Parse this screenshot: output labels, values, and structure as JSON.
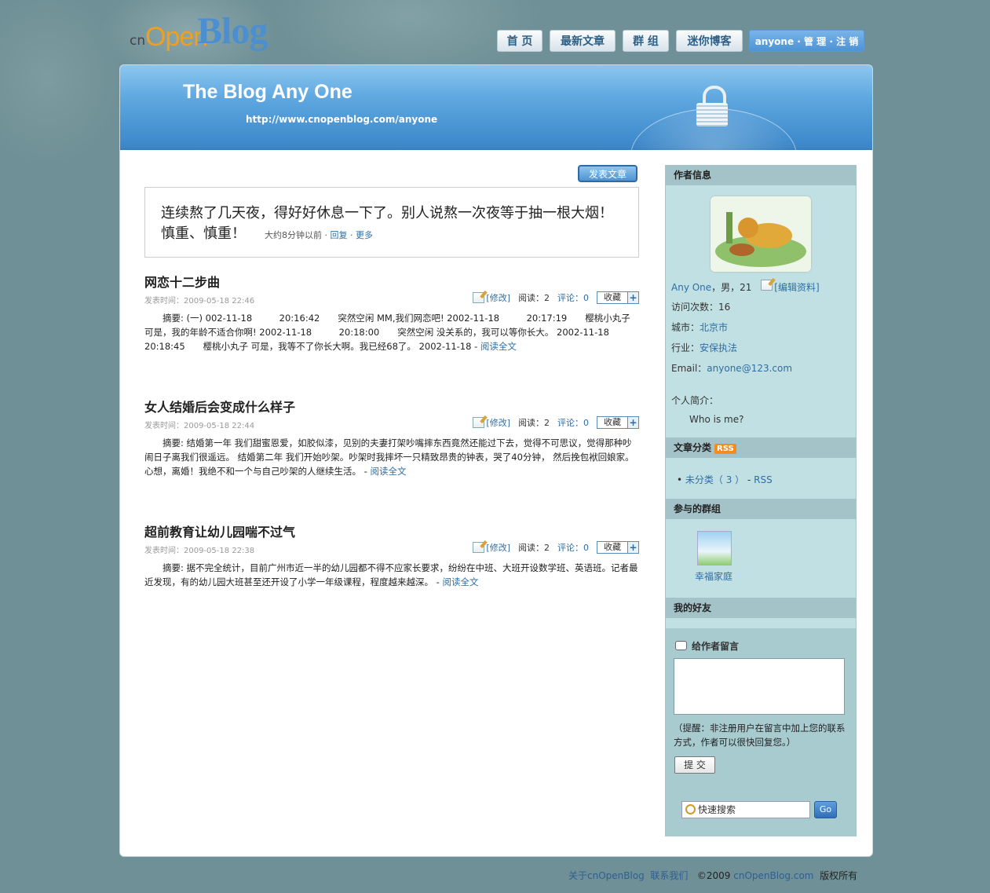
{
  "logo": {
    "cn": "cn",
    "open": "Open",
    "blog": "Blog"
  },
  "nav": [
    "首 页",
    "最新文章",
    "群 组",
    "迷你博客",
    "anyone · 管 理 · 注 销"
  ],
  "banner": {
    "title": "The Blog Any One",
    "url": "http://www.cnopenblog.com/anyone"
  },
  "post_button": "发表文章",
  "mini": {
    "text": "连续熬了几天夜，得好好休息一下了。别人说熬一次夜等于抽一根大烟！慎重、慎重！",
    "time": "大约8分钟以前",
    "reply": "回复",
    "more": "更多"
  },
  "articles": [
    {
      "title": "网恋十二步曲",
      "time": "发表时间：2009-05-18 22:46",
      "edit": "[修改]",
      "reads": "阅读：2",
      "comments": "评论：0",
      "fav": "收藏",
      "summary": "摘要: (一) 002-11-18　　　20:16:42　　突然空闲 MM,我们网恋吧! 2002-11-18　　　20:17:19　　樱桃小丸子 可是，我的年龄不适合你啊! 2002-11-18　　　20:18:00　　突然空闲 没关系的，我可以等你长大。 2002-11-18　　　20:18:45　　樱桃小丸子 可是，我等不了你长大啊。我已经68了。 2002-11-18 ",
      "read_more": "阅读全文"
    },
    {
      "title": "女人结婚后会变成什么样子",
      "time": "发表时间：2009-05-18 22:44",
      "edit": "[修改]",
      "reads": "阅读：2",
      "comments": "评论：0",
      "fav": "收藏",
      "summary": "摘要: 结婚第一年 我们甜蜜恩爱，如胶似漆，见别的夫妻打架吵嘴摔东西竟然还能过下去，觉得不可思议，觉得那种吵闹日子离我们很遥远。 结婚第二年 我们开始吵架。吵架时我摔坏一只精致昂贵的钟表，哭了40分钟， 然后挽包袱回娘家。心想，离婚！我绝不和一个与自己吵架的人继续生活。 ",
      "read_more": "阅读全文"
    },
    {
      "title": "超前教育让幼儿园喘不过气",
      "time": "发表时间：2009-05-18 22:38",
      "edit": "[修改]",
      "reads": "阅读：2",
      "comments": "评论：0",
      "fav": "收藏",
      "summary": "摘要: 据不完全统计，目前广州市近一半的幼儿园都不得不应家长要求，纷纷在中班、大班开设数学班、英语班。记者最近发现，有的幼儿园大班甚至还开设了小学一年级课程，程度越来越深。 ",
      "read_more": "阅读全文"
    }
  ],
  "sidebar": {
    "author_title": "作者信息",
    "author_name": "Any One",
    "author_meta": "，男，21",
    "edit_profile": "[编辑资料]",
    "visits": "访问次数：16",
    "city_label": "城市：",
    "city": "北京市",
    "industry_label": "行业：",
    "industry": "安保执法",
    "email_label": "Email：",
    "email": "anyone@123.com",
    "intro_label": "个人简介：",
    "intro": "Who is me?",
    "category_title": "文章分类",
    "rss_badge": "RSS",
    "category_item": "未分类（ 3 ）",
    "category_rss": "RSS",
    "groups_title": "参与的群组",
    "group_name": "幸福家庭",
    "friends_title": "我的好友",
    "message_title": "给作者留言",
    "message_note": "（提醒：非注册用户在留言中加上您的联系方式，作者可以很快回复您。）",
    "submit": "提 交",
    "search_placeholder": "快速搜索",
    "go": "Go"
  },
  "footer": {
    "about": "关于cnOpenBlog",
    "contact": "联系我们",
    "copy": "©2009",
    "site": "cnOpenBlog.com",
    "rights": "版权所有"
  }
}
